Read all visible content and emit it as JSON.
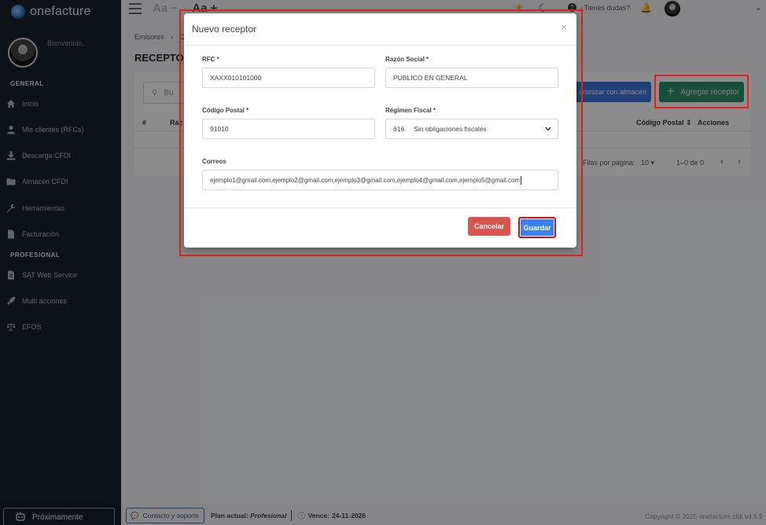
{
  "brand": {
    "name": "onefacture"
  },
  "sidebar": {
    "welcome": "Bienvenido,",
    "sections": [
      {
        "title": "GENERAL",
        "items": [
          {
            "label": "Inicio",
            "icon": "home-icon"
          },
          {
            "label": "Mis clientes (RFCs)",
            "icon": "user-icon"
          },
          {
            "label": "Descarga CFDI",
            "icon": "download-icon"
          },
          {
            "label": "Almacén CFDI",
            "icon": "folder-icon"
          },
          {
            "label": "Herramientas",
            "icon": "wrench-icon"
          },
          {
            "label": "Facturación",
            "icon": "file-icon"
          }
        ]
      },
      {
        "title": "PROFESIONAL",
        "items": [
          {
            "label": "SAT Web Service",
            "icon": "file-code-icon"
          },
          {
            "label": "Multi acciones",
            "icon": "rocket-icon"
          },
          {
            "label": "EFOS",
            "icon": "scale-icon"
          }
        ]
      }
    ],
    "bottom_button": "Próximamente"
  },
  "topbar": {
    "font_decrease": "Aa −",
    "font_increase": "Aa +",
    "help": "¿Tienes dudas?"
  },
  "page": {
    "breadcrumb": {
      "root": "Emisores",
      "current": "C"
    },
    "title": "RECEPTOR",
    "search_placeholder": "Bu",
    "sync_button": "cronizar con almacén",
    "add_button": "Agregar receptor",
    "table_headers": {
      "index": "#",
      "name": "Raz",
      "postal": "Código Postal",
      "actions": "Acciones"
    },
    "pagination": {
      "rows_label": "Filas por página:",
      "rows_value": "10",
      "range": "1–0 de 0"
    }
  },
  "modal": {
    "title": "Nuevo receptor",
    "fields": {
      "rfc": {
        "label": "RFC *",
        "value": "XAXX010101000"
      },
      "razon_social": {
        "label": "Razón Social *",
        "value": "PUBLICO EN GENERAL"
      },
      "codigo_postal": {
        "label": "Código Postal *",
        "value": "91010"
      },
      "regimen_fiscal": {
        "label": "Régimen Fiscal *",
        "code": "616",
        "value": "Sin obligaciones fiscales"
      },
      "correos": {
        "label": "Correos",
        "value": "ejemplo1@gmail.com,ejemplo2@gmail.com,ejemplo3@gmail.com,ejemplo4@gmail.com,ejemplo5@gmail.com"
      }
    },
    "cancel_label": "Cancelar",
    "save_label": "Guardar"
  },
  "footer": {
    "contact": "Contacto y soporte",
    "plan_label": "Plan actual:",
    "plan_value": "Profesional",
    "expires_label": "Vence:",
    "expires_value": "24-11-2026",
    "copyright": "Copyright © 2025 onefacture cfdi v4.5.9"
  },
  "colors": {
    "sidebar_bg": "#19222f",
    "primary": "#3b82f0",
    "success": "#2f8f6c",
    "danger": "#d9534f",
    "highlight": "#e02020"
  }
}
